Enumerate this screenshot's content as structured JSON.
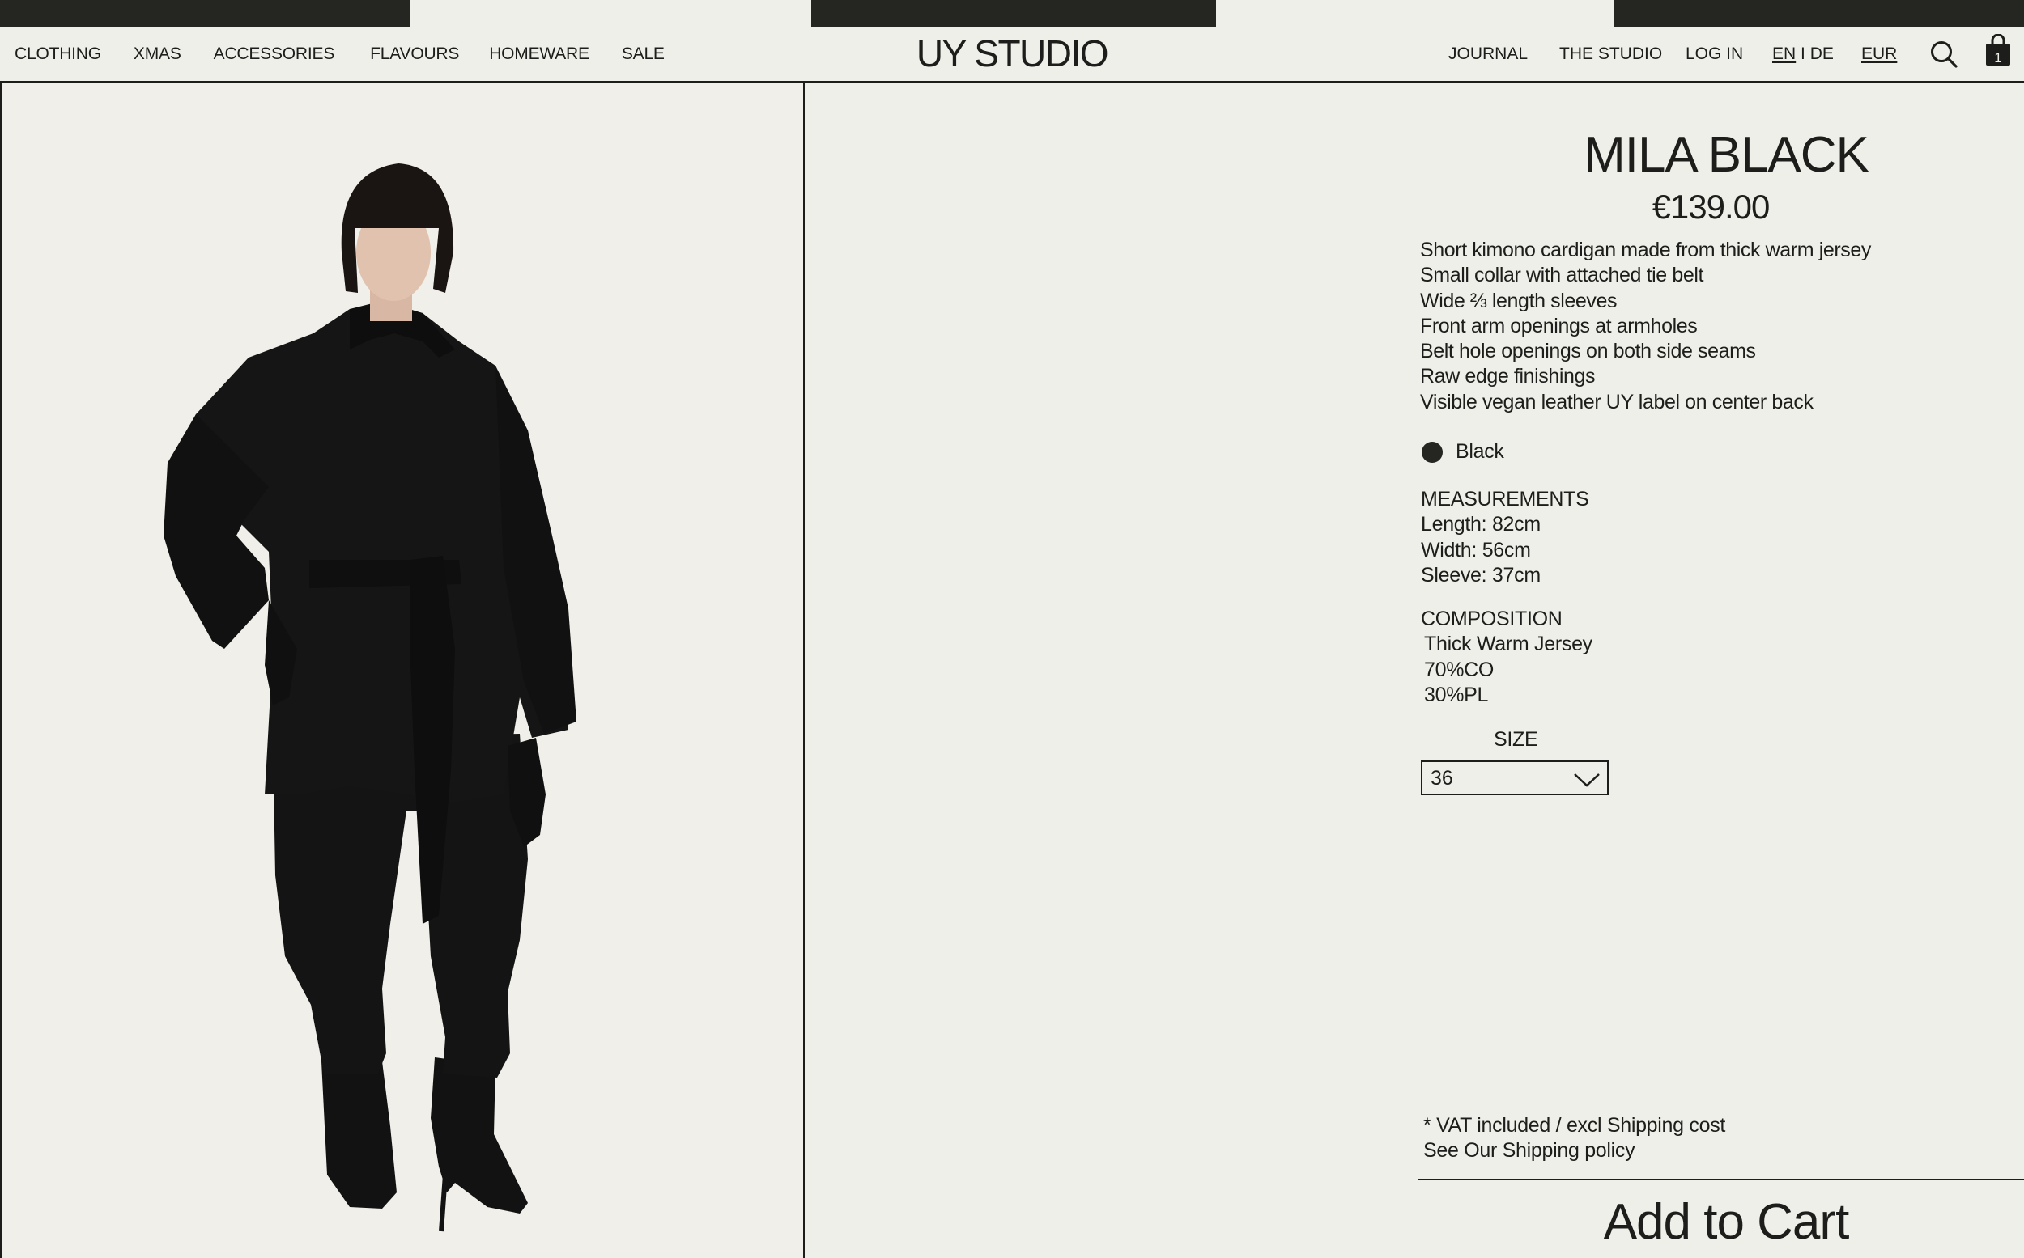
{
  "header": {
    "logo": "UY STUDIO",
    "nav_left": [
      "CLOTHING",
      "XMAS",
      "ACCESSORIES",
      "FLAVOURS",
      "HOMEWARE",
      "SALE"
    ],
    "nav_right": {
      "journal": "JOURNAL",
      "studio": "THE STUDIO",
      "login": "LOG IN",
      "lang_en": "EN",
      "lang_sep": " I ",
      "lang_de": "DE",
      "currency": "EUR"
    },
    "cart_count": "1",
    "icons": [
      "search-icon",
      "shopping-bag-icon"
    ]
  },
  "product": {
    "title": "MILA BLACK",
    "price": "€139.00",
    "description": [
      "Short kimono cardigan made from thick warm jersey",
      "Small collar with attached tie belt",
      "Wide ⅔ length sleeves",
      "Front arm openings at armholes",
      "Belt hole openings on both side seams",
      "Raw edge finishings",
      "Visible vegan leather UY label on center back"
    ],
    "color": {
      "name": "Black",
      "hex": "#252622"
    },
    "measurements": {
      "heading": "MEASUREMENTS",
      "lines": [
        "Length: 82cm",
        "Width: 56cm",
        "Sleeve: 37cm"
      ]
    },
    "composition": {
      "heading": "COMPOSITION",
      "lines": [
        "Thick Warm Jersey",
        "70%CO",
        "30%PL"
      ]
    },
    "size": {
      "label": "SIZE",
      "selected": "36"
    },
    "vat_note": "* VAT included / excl Shipping cost",
    "shipping_link": "See Our Shipping policy",
    "add_to_cart": "Add to Cart"
  },
  "colors": {
    "background": "#efefe9",
    "text": "#1d1d1b",
    "garment": "#161616"
  }
}
